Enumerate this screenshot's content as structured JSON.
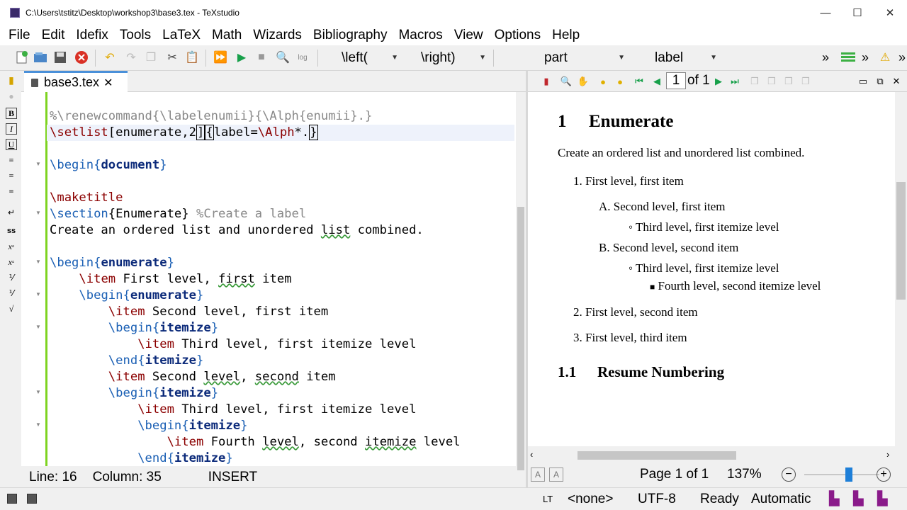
{
  "window": {
    "title": "C:\\Users\\tstitz\\Desktop\\workshop3\\base3.tex - TeXstudio",
    "min": "—",
    "max": "☐",
    "close": "✕"
  },
  "menu": [
    "File",
    "Edit",
    "Idefix",
    "Tools",
    "LaTeX",
    "Math",
    "Wizards",
    "Bibliography",
    "Macros",
    "View",
    "Options",
    "Help"
  ],
  "toolbar": {
    "left_combo": "\\left(",
    "right_combo": "\\right)",
    "part_combo": "part",
    "label_combo": "label",
    "more": "»"
  },
  "tab": {
    "label": "base3.tex",
    "close": "✕"
  },
  "editor_lines": [
    [
      {
        "t": "%\\renewcommand{\\labelenumii}{\\Alph{enumii}.}",
        "c": "cm"
      }
    ],
    [
      {
        "t": "\\setlist",
        "c": "cmd"
      },
      {
        "t": "[enumerate,2"
      },
      {
        "t": "]",
        "c": "cursor"
      },
      {
        "t": "{",
        "c": "cursor"
      },
      {
        "t": "label="
      },
      {
        "t": "\\Alph",
        "c": "cmd"
      },
      {
        "t": "*."
      },
      {
        "t": "}",
        "c": "cursor"
      }
    ],
    [],
    [
      {
        "t": "\\begin",
        "c": "kw"
      },
      {
        "t": "{",
        "c": "kw"
      },
      {
        "t": "document",
        "c": "env"
      },
      {
        "t": "}",
        "c": "kw"
      }
    ],
    [],
    [
      {
        "t": "\\maketitle",
        "c": "cmd"
      }
    ],
    [
      {
        "t": "\\section",
        "c": "kw"
      },
      {
        "t": "{Enumerate} "
      },
      {
        "t": "%Create a label",
        "c": "cm"
      }
    ],
    [
      {
        "t": "Create an ordered list and unordered "
      },
      {
        "t": "list",
        "c": "wv"
      },
      {
        "t": " combined."
      }
    ],
    [],
    [
      {
        "t": "\\begin",
        "c": "kw"
      },
      {
        "t": "{",
        "c": "kw"
      },
      {
        "t": "enumerate",
        "c": "env"
      },
      {
        "t": "}",
        "c": "kw"
      }
    ],
    [
      {
        "t": "    "
      },
      {
        "t": "\\item",
        "c": "cmd"
      },
      {
        "t": " First level, "
      },
      {
        "t": "first",
        "c": "wv"
      },
      {
        "t": " item"
      }
    ],
    [
      {
        "t": "    "
      },
      {
        "t": "\\begin",
        "c": "kw"
      },
      {
        "t": "{",
        "c": "kw"
      },
      {
        "t": "enumerate",
        "c": "env"
      },
      {
        "t": "}",
        "c": "kw"
      }
    ],
    [
      {
        "t": "        "
      },
      {
        "t": "\\item",
        "c": "cmd"
      },
      {
        "t": " Second level, first item"
      }
    ],
    [
      {
        "t": "        "
      },
      {
        "t": "\\begin",
        "c": "kw"
      },
      {
        "t": "{",
        "c": "kw"
      },
      {
        "t": "itemize",
        "c": "env"
      },
      {
        "t": "}",
        "c": "kw"
      }
    ],
    [
      {
        "t": "            "
      },
      {
        "t": "\\item",
        "c": "cmd"
      },
      {
        "t": " Third level, first itemize level"
      }
    ],
    [
      {
        "t": "        "
      },
      {
        "t": "\\end",
        "c": "kw"
      },
      {
        "t": "{",
        "c": "kw"
      },
      {
        "t": "itemize",
        "c": "env"
      },
      {
        "t": "}",
        "c": "kw"
      }
    ],
    [
      {
        "t": "        "
      },
      {
        "t": "\\item",
        "c": "cmd"
      },
      {
        "t": " Second "
      },
      {
        "t": "level",
        "c": "wv"
      },
      {
        "t": ", "
      },
      {
        "t": "second",
        "c": "wv"
      },
      {
        "t": " item"
      }
    ],
    [
      {
        "t": "        "
      },
      {
        "t": "\\begin",
        "c": "kw"
      },
      {
        "t": "{",
        "c": "kw"
      },
      {
        "t": "itemize",
        "c": "env"
      },
      {
        "t": "}",
        "c": "kw"
      }
    ],
    [
      {
        "t": "            "
      },
      {
        "t": "\\item",
        "c": "cmd"
      },
      {
        "t": " Third level, first itemize level"
      }
    ],
    [
      {
        "t": "            "
      },
      {
        "t": "\\begin",
        "c": "kw"
      },
      {
        "t": "{",
        "c": "kw"
      },
      {
        "t": "itemize",
        "c": "env"
      },
      {
        "t": "}",
        "c": "kw"
      }
    ],
    [
      {
        "t": "                "
      },
      {
        "t": "\\item",
        "c": "cmd"
      },
      {
        "t": " Fourth "
      },
      {
        "t": "level",
        "c": "wv"
      },
      {
        "t": ", second "
      },
      {
        "t": "itemize",
        "c": "wv"
      },
      {
        "t": " level"
      }
    ],
    [
      {
        "t": "            "
      },
      {
        "t": "\\end",
        "c": "kw"
      },
      {
        "t": "{",
        "c": "kw"
      },
      {
        "t": "itemize",
        "c": "env"
      },
      {
        "t": "}",
        "c": "kw"
      }
    ]
  ],
  "status": {
    "line": "Line: 16",
    "column": "Column: 35",
    "mode": "INSERT"
  },
  "pdf_toolbar": {
    "page_input": "1",
    "of_pages": "of 1"
  },
  "preview": {
    "section_num": "1",
    "section_title": "Enumerate",
    "intro": "Create an ordered list and unordered list combined.",
    "items": [
      {
        "marker": "1.",
        "text": "First level, first item"
      },
      {
        "marker": "A.",
        "text": "Second level, first item"
      },
      {
        "marker": "◦",
        "text": "Third level, first itemize level"
      },
      {
        "marker": "B.",
        "text": "Second level, second item"
      },
      {
        "marker": "◦",
        "text": "Third level, first itemize level"
      },
      {
        "marker": "■",
        "text": "Fourth level, second itemize level"
      },
      {
        "marker": "2.",
        "text": "First level, second item"
      },
      {
        "marker": "3.",
        "text": "First level, third item"
      }
    ],
    "subsection_num": "1.1",
    "subsection_title": "Resume Numbering"
  },
  "pdf_status": {
    "page": "Page 1 of 1",
    "zoom": "137%",
    "zoom_fraction": 0.6
  },
  "bottom": {
    "lang": "<none>",
    "encoding": "UTF-8",
    "ready": "Ready",
    "mode": "Automatic"
  }
}
